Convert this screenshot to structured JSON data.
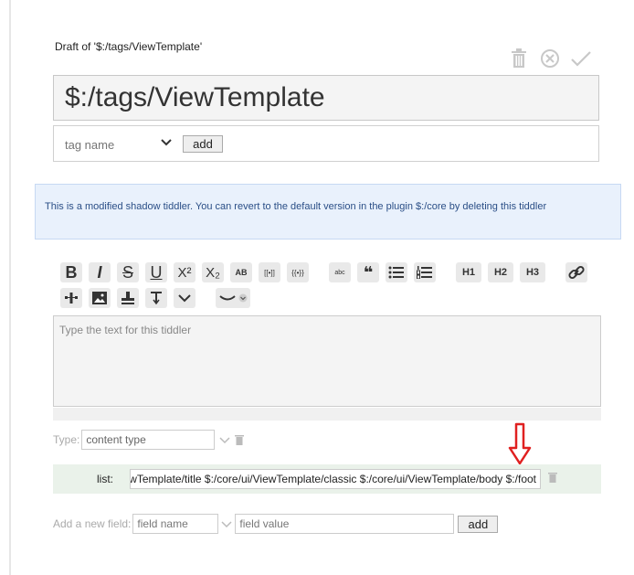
{
  "draft": {
    "heading": "Draft of '$:/tags/ViewTemplate'"
  },
  "title": {
    "value": "$:/tags/ViewTemplate"
  },
  "tags": {
    "placeholder": "tag name",
    "add_label": "add"
  },
  "notice": {
    "text": "This is a modified shadow tiddler. You can revert to the default version in the plugin $:/core by deleting this tiddler"
  },
  "toolbar": {
    "bold": "B",
    "italic": "I",
    "strike": "S",
    "underline": "U",
    "superscript": "X²",
    "subscript": "X₂",
    "smallcaps": "AB",
    "link_wiki": "[[•]]",
    "transclude": "{{•}}",
    "mono_block": "abc",
    "quote": "❝",
    "h1": "H1",
    "h2": "H2",
    "h3": "H3"
  },
  "body": {
    "placeholder": "Type the text for this tiddler"
  },
  "type": {
    "label": "Type:",
    "placeholder": "content type"
  },
  "list_field": {
    "label": "list:",
    "value": "$:/tags/ViewTemplate/title $:/core/ui/ViewTemplate/classic $:/core/ui/ViewTemplate/body $:/foot"
  },
  "new_field": {
    "label": "Add a new field:",
    "name_placeholder": "field name",
    "value_placeholder": "field value",
    "add_label": "add"
  },
  "colors": {
    "accent_arrow": "#e02020",
    "notice_bg": "#e9f1fc",
    "list_bg": "#eaf2ea"
  }
}
